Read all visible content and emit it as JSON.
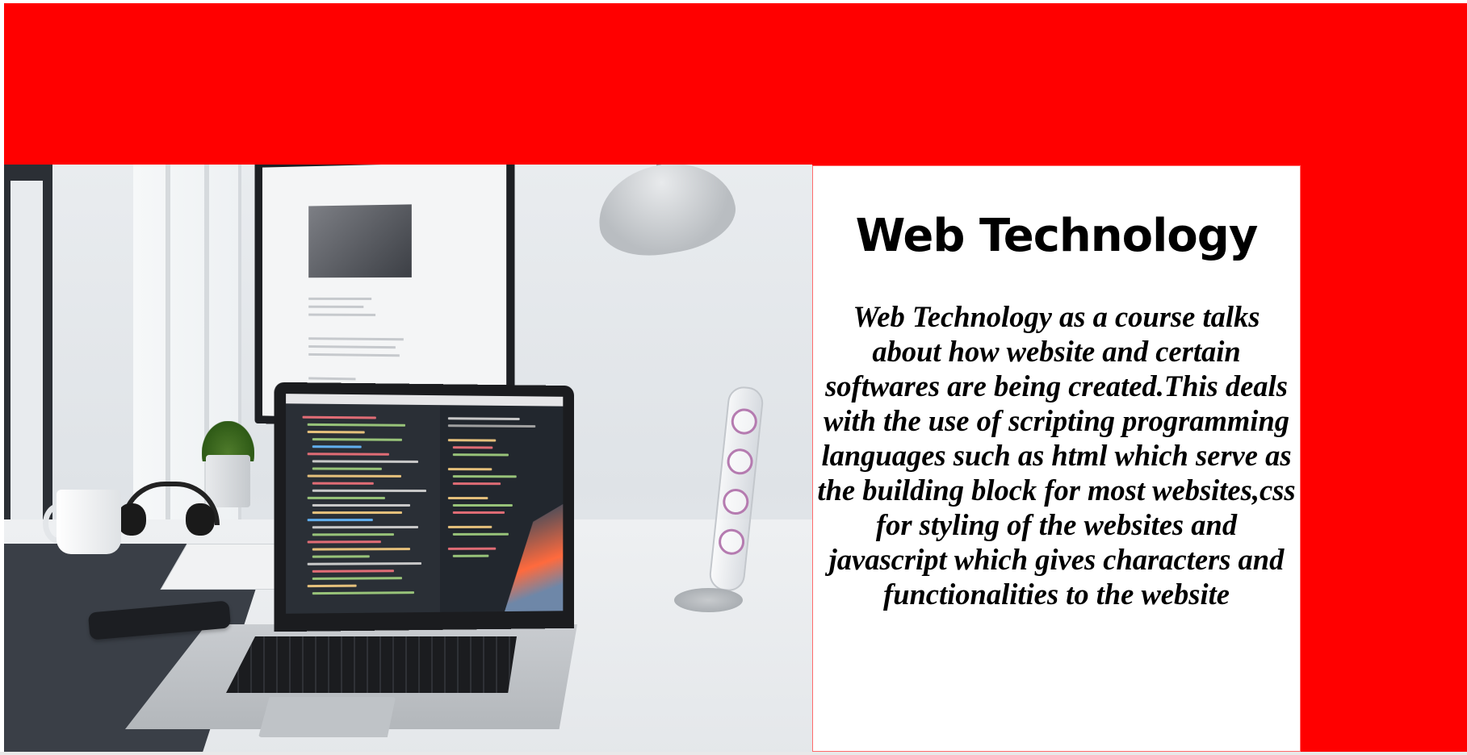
{
  "header": {
    "background_color": "#ff0000"
  },
  "hero_image": {
    "description_icon": "laptop-desk-photo"
  },
  "card": {
    "title": "Web Technology",
    "body": "Web Technology as a course talks about how website and certain softwares are being created.This deals with the use of scripting programming languages such as html which serve as the building block for most websites,css for styling of the websites and javascript which gives characters and functionalities to the website"
  },
  "colors": {
    "accent": "#ff0000",
    "card_background": "#ffffff",
    "card_border": "#ff6b6b",
    "text": "#000000"
  }
}
